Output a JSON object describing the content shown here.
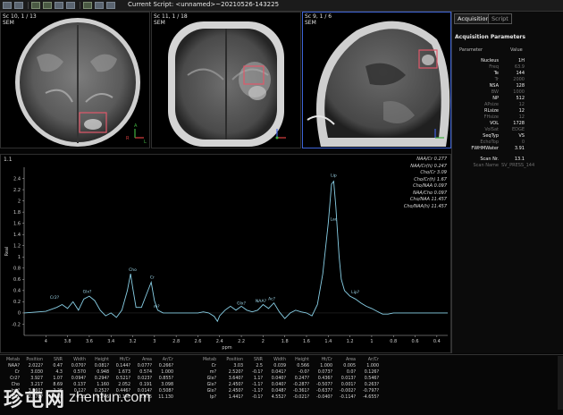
{
  "toolbar": {
    "script_label": "Current Script: <unnamed>~20210526-143225"
  },
  "viewports": [
    {
      "label_line1": "Sc 10, 1 / 13",
      "label_line2": "SEM"
    },
    {
      "label_line1": "Sc 11, 1 / 18",
      "label_line2": "SEM"
    },
    {
      "label_line1": "Sc 9, 1 / 6",
      "label_line2": "SEM"
    }
  ],
  "right_panel": {
    "tabs": [
      "Acquisition",
      "Script"
    ],
    "title": "Acquisition Parameters",
    "col_param": "Parameter",
    "col_value": "Value",
    "params": [
      {
        "name": "Nucleus",
        "value": "1H",
        "bright": true
      },
      {
        "name": "Freq",
        "value": "63.9",
        "bright": false
      },
      {
        "name": "Te",
        "value": "144",
        "bright": true
      },
      {
        "name": "Tr",
        "value": "2000",
        "bright": false
      },
      {
        "name": "NSA",
        "value": "128",
        "bright": true
      },
      {
        "name": "BW",
        "value": "1000",
        "bright": false
      },
      {
        "name": "NP",
        "value": "512",
        "bright": true
      },
      {
        "name": "APsize",
        "value": "12",
        "bright": false
      },
      {
        "name": "RLsize",
        "value": "12",
        "bright": true
      },
      {
        "name": "FHsize",
        "value": "12",
        "bright": false
      },
      {
        "name": "VOL",
        "value": "1728",
        "bright": true
      },
      {
        "name": "VolSat",
        "value": "EDGE",
        "bright": false
      },
      {
        "name": "SeqTyp",
        "value": "VS",
        "bright": true
      },
      {
        "name": "EchoTop",
        "value": "0",
        "bright": false
      },
      {
        "name": "FWHMWater",
        "value": "3.91",
        "bright": true
      }
    ],
    "scan_nr_label": "Scan Nr.",
    "scan_nr_value": "13.1",
    "scan_name_label": "Scan Name",
    "scan_name_value": "SV_PRESS_144"
  },
  "spectrum": {
    "label": "1.1",
    "ratios": [
      "NAA/Cr 0.277",
      "NAA/Cr(h) 0.247",
      "Cho/Cr 3.09",
      "Cho/Cr(h) 1.67",
      "Cho/NAA 0.097",
      "NAA/Cho 0.097",
      "Cho/NAA 11.457",
      "Cho/NAA(h) 11.457"
    ],
    "ylabel": "Real",
    "xlabel": "ppm",
    "peaks": [
      "Cr2?",
      "Glx?",
      "m?",
      "Cho",
      "Cr",
      "Glx?",
      "NAA?",
      "Ac?",
      "Lip",
      "Lac",
      "Lip?"
    ]
  },
  "chart_data": {
    "type": "line",
    "xlabel": "ppm",
    "ylabel": "Real",
    "x_reversed": true,
    "xlim": [
      0.3,
      4.2
    ],
    "ylim": [
      -0.4,
      2.6
    ],
    "x_ticks": [
      4,
      3.8,
      3.6,
      3.4,
      3.2,
      3,
      2.8,
      2.6,
      2.4,
      2.2,
      2,
      1.8,
      1.6,
      1.4,
      1.2,
      1,
      0.8,
      0.6,
      0.4
    ],
    "y_ticks": [
      2.4,
      2.2,
      2.0,
      1.8,
      1.6,
      1.4,
      1.2,
      1.0,
      0.8,
      0.6,
      0.4,
      0.2,
      0,
      -0.2
    ],
    "series": [
      {
        "x": [
          4.2,
          4.0,
          3.9,
          3.85,
          3.8,
          3.75,
          3.7,
          3.65,
          3.6,
          3.55,
          3.5,
          3.45,
          3.4,
          3.35,
          3.3,
          3.25,
          3.22,
          3.2,
          3.17,
          3.12,
          3.08,
          3.03,
          3.0,
          2.97,
          2.92,
          2.85,
          2.75,
          2.65,
          2.6,
          2.55,
          2.5,
          2.45,
          2.42,
          2.4,
          2.35,
          2.3,
          2.25,
          2.2,
          2.15,
          2.1,
          2.05,
          2.0,
          1.95,
          1.9,
          1.85,
          1.8,
          1.75,
          1.7,
          1.65,
          1.6,
          1.55,
          1.5,
          1.45,
          1.4,
          1.37,
          1.35,
          1.33,
          1.32,
          1.3,
          1.28,
          1.25,
          1.2,
          1.15,
          1.1,
          1.05,
          1.0,
          0.95,
          0.9,
          0.85,
          0.8,
          0.6,
          0.3
        ],
        "y": [
          0,
          0.03,
          0.1,
          0.15,
          0.08,
          0.2,
          0.05,
          0.25,
          0.3,
          0.22,
          0.05,
          -0.05,
          0.0,
          -0.08,
          0.05,
          0.4,
          0.7,
          0.45,
          0.1,
          0.1,
          0.3,
          0.55,
          0.22,
          0.05,
          0.0,
          0.0,
          0.0,
          0.0,
          0.0,
          0.02,
          0.0,
          -0.06,
          -0.15,
          -0.05,
          0.05,
          0.12,
          0.05,
          0.12,
          0.05,
          0.02,
          0.05,
          0.15,
          0.08,
          0.18,
          0.02,
          -0.1,
          0.0,
          0.05,
          0.02,
          0.0,
          -0.05,
          0.15,
          0.7,
          1.6,
          2.3,
          2.35,
          1.9,
          1.6,
          1.0,
          0.6,
          0.4,
          0.3,
          0.25,
          0.18,
          0.12,
          0.08,
          0.03,
          -0.02,
          -0.02,
          0,
          0,
          0
        ]
      }
    ]
  },
  "tables": {
    "left": {
      "headers": [
        "Metab",
        "Position",
        "SNR",
        "Width",
        "Height",
        "Ht/Cr",
        "Area",
        "Ar/Cr"
      ],
      "rows": [
        [
          "NAA?",
          "2.022?",
          "0.47",
          "0.070?",
          "0.081?",
          "0.144?",
          "0.077?",
          "0.266?"
        ],
        [
          "Cr",
          "3.030",
          "4.3",
          "0.570",
          "0.948",
          "1.673",
          "0.574",
          "1.000"
        ],
        [
          "Cr2?",
          "3.927",
          "1.07",
          "0.094?",
          "0.294?",
          "0.521?",
          "0.023?",
          "0.855?"
        ],
        [
          "Cho",
          "3.217",
          "8.69",
          "0.137",
          "1.160",
          "2.052",
          "0.191",
          "3.098"
        ],
        [
          "Ins?",
          "3.560?",
          "2.26",
          "0.12?",
          "0.252?",
          "0.446?",
          "0.014?",
          "0.508?"
        ],
        [
          "Glx",
          "2.378?",
          "4.98",
          "0.15",
          "0.246",
          "0.140",
          "0.475",
          "11.130"
        ]
      ]
    },
    "right": {
      "headers": [
        "Metab",
        "Position",
        "SNR",
        "Width",
        "Height",
        "Ht/Cr",
        "Area",
        "Ar/Cr"
      ],
      "rows": [
        [
          "Cr",
          "3.03",
          "2.5",
          "0.039",
          "0.566",
          "1.000",
          "0.005",
          "1.000"
        ],
        [
          "m?",
          "2.520?",
          "-0.1?",
          "0.041?",
          "-0.0?",
          "0.073?",
          "0.0?",
          "0.126?"
        ],
        [
          "Glx?",
          "3.640?",
          "1.1?",
          "0.040?",
          "0.247?",
          "0.436?",
          "0.013?",
          "0.546?"
        ],
        [
          "Glx?",
          "2.450?",
          "-1.1?",
          "0.040?",
          "-0.287?",
          "-0.507?",
          "0.001?",
          "0.263?"
        ],
        [
          "Glx?",
          "2.450?",
          "-1.1?",
          "0.048?",
          "-0.361?",
          "-0.637?",
          "-0.002?",
          "-0.797?"
        ],
        [
          "Ip?",
          "1.441?",
          "-0.1?",
          "4.552?",
          "-0.021?",
          "-0.040?",
          "-0.114?",
          "-4.655?"
        ]
      ]
    }
  },
  "watermark": {
    "cn": "珍屯网",
    "url": "zhentun.com"
  },
  "colors": {
    "trace": "#88cfe6",
    "roi": "#e0586a",
    "axis_x": "#d84040",
    "axis_y": "#40b040",
    "axis_z": "#4060e0",
    "active_border": "#3d63d6"
  }
}
